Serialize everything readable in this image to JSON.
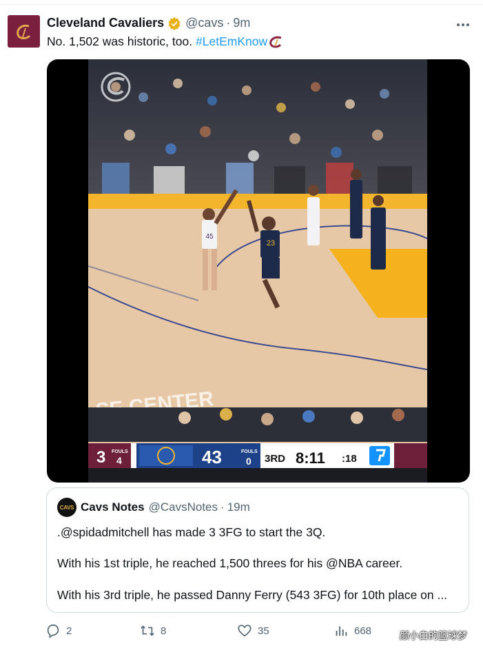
{
  "tweet": {
    "author_name": "Cleveland Cavaliers",
    "handle": "@cavs",
    "separator": "·",
    "time": "9m",
    "text": "No. 1,502 was historic, too.",
    "hashtag": "#LetEmKnow",
    "verified": true
  },
  "video": {
    "scorebug": {
      "away_score": "3",
      "away_fouls_label": "FOULS",
      "away_fouls": "4",
      "home_score": "43",
      "home_fouls_label": "FOULS",
      "home_fouls": "0",
      "quarter": "3RD",
      "game_clock": "8:11",
      "shot_clock": ":18"
    },
    "jersey_left": "45",
    "jersey_right": "23",
    "arena_banner": "SE  CENTER"
  },
  "quote": {
    "avatar_text": "CAVS",
    "author_name": "Cavs Notes",
    "handle": "@CavsNotes",
    "separator": "·",
    "time": "19m",
    "line1": ".@spidadmitchell has made 3 3FG to start the 3Q.",
    "line2": "With his 1st triple, he reached 1,500 threes for his @NBA career.",
    "line3": "With his 3rd triple, he passed Danny Ferry (543 3FG) for 10th place on ..."
  },
  "actions": {
    "replies": "2",
    "retweets": "8",
    "likes": "35",
    "views": "668"
  },
  "watermark": "颜小白的篮球梦",
  "colors": {
    "link": "#1d9bf0",
    "secondary_text": "#536471",
    "cavs_wine": "#7a1f3d",
    "border": "#cfd9de"
  }
}
